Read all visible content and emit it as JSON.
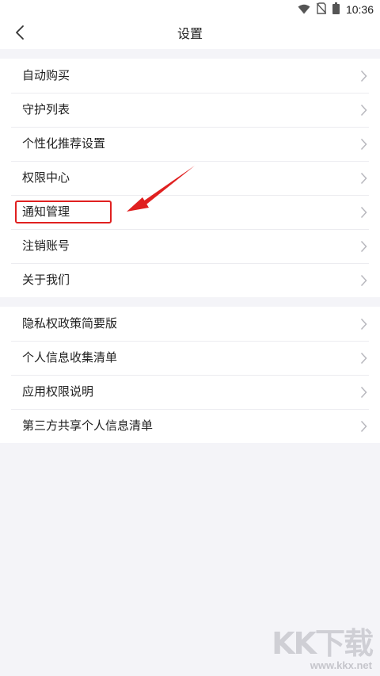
{
  "status_bar": {
    "time": "10:36",
    "icons": [
      "wifi-icon",
      "no-sim-icon",
      "battery-icon"
    ]
  },
  "header": {
    "title": "设置",
    "back_icon": "chevron-left-icon"
  },
  "groups": [
    {
      "items": [
        {
          "label": "自动购买"
        },
        {
          "label": "守护列表"
        },
        {
          "label": "个性化推荐设置"
        },
        {
          "label": "权限中心"
        },
        {
          "label": "通知管理"
        },
        {
          "label": "注销账号"
        },
        {
          "label": "关于我们"
        }
      ]
    },
    {
      "items": [
        {
          "label": "隐私权政策简要版"
        },
        {
          "label": "个人信息收集清单"
        },
        {
          "label": "应用权限说明"
        },
        {
          "label": "第三方共享个人信息清单"
        }
      ]
    }
  ],
  "annotation": {
    "highlighted_item": "通知管理",
    "color": "#e02020"
  },
  "watermark": {
    "logo": "KK下载",
    "url": "www.kkx.net"
  },
  "colors": {
    "background": "#f4f4f8",
    "surface": "#ffffff",
    "text": "#222222",
    "chevron": "#b8b8be",
    "annotation": "#e02020"
  }
}
